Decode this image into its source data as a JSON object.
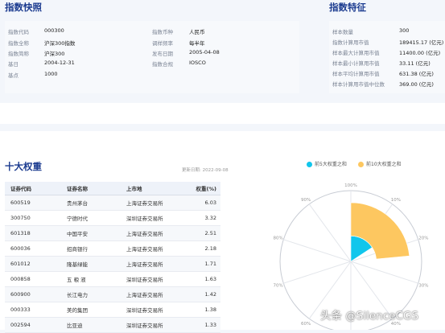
{
  "quick_view": {
    "title": "指数快照",
    "left": [
      {
        "label": "指数代码",
        "value": "000300"
      },
      {
        "label": "指数全称",
        "value": "沪深300指数"
      },
      {
        "label": "指数简称",
        "value": "沪深300"
      },
      {
        "label": "基日",
        "value": "2004-12-31"
      },
      {
        "label": "基点",
        "value": "1000"
      }
    ],
    "right": [
      {
        "label": "指数币种",
        "value": "人民币"
      },
      {
        "label": "调样频率",
        "value": "每半年"
      },
      {
        "label": "发布日期",
        "value": "2005-04-08"
      },
      {
        "label": "指数合规",
        "value": "IOSCO"
      }
    ]
  },
  "features": {
    "title": "指数特征",
    "rows": [
      {
        "label": "样本数量",
        "value": "300"
      },
      {
        "label": "指数计算用市值",
        "value": "189415.17 (亿元)"
      },
      {
        "label": "样本最大计算用市值",
        "value": "11400.00 (亿元)"
      },
      {
        "label": "样本最小计算用市值",
        "value": "33.11 (亿元)"
      },
      {
        "label": "样本平均计算用市值",
        "value": "631.38 (亿元)"
      },
      {
        "label": "样本计算用市值中位数",
        "value": "369.00 (亿元)"
      }
    ]
  },
  "weights": {
    "title": "十大权重",
    "date_label": "更新日期: 2022-09-08",
    "headers": [
      "证券代码",
      "证券名称",
      "上市地",
      "权重(%)"
    ],
    "rows": [
      [
        "600519",
        "贵州茅台",
        "上海证券交易所",
        "6.03"
      ],
      [
        "300750",
        "宁德时代",
        "深圳证券交易所",
        "3.32"
      ],
      [
        "601318",
        "中国平安",
        "上海证券交易所",
        "2.51"
      ],
      [
        "600036",
        "招商银行",
        "上海证券交易所",
        "2.18"
      ],
      [
        "601012",
        "隆基绿能",
        "上海证券交易所",
        "1.71"
      ],
      [
        "000858",
        "五 粮 液",
        "深圳证券交易所",
        "1.63"
      ],
      [
        "600900",
        "长江电力",
        "上海证券交易所",
        "1.42"
      ],
      [
        "000333",
        "美的集团",
        "深圳证券交易所",
        "1.38"
      ],
      [
        "002594",
        "比亚迪",
        "深圳证券交易所",
        "1.33"
      ]
    ]
  },
  "chart_data": {
    "type": "pie",
    "legend": [
      {
        "name": "前5大权重之和",
        "color": "#11c6ec"
      },
      {
        "name": "前10大权重之和",
        "color": "#fdc760"
      }
    ],
    "legend_position": "top",
    "scale_labels": [
      "100%",
      "10%",
      "20%",
      "30%",
      "40%",
      "50%",
      "60%",
      "70%",
      "80%",
      "90%"
    ],
    "series": [
      {
        "name": "前5大权重之和",
        "value": 15.75,
        "color": "#11c6ec"
      },
      {
        "name": "前10大权重之和",
        "value": 23.5,
        "color": "#fdc760"
      }
    ],
    "max": 100
  },
  "watermark": "头条 @SilenceCGS"
}
